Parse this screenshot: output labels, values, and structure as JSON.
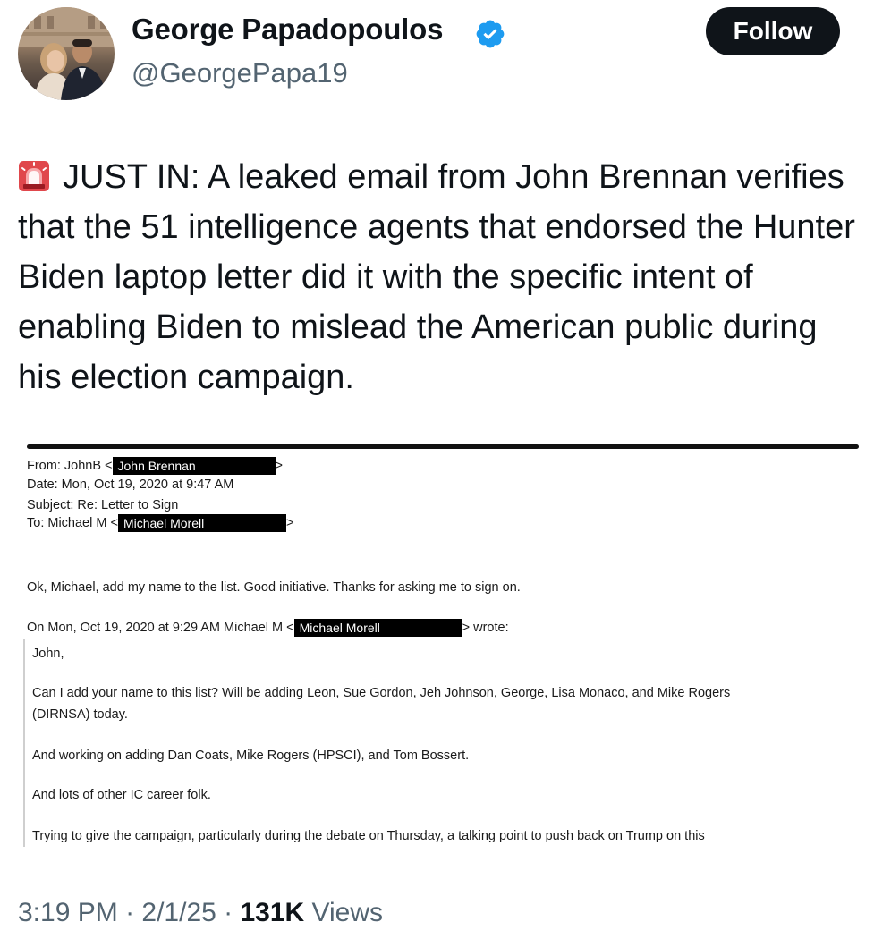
{
  "author": {
    "name": "George Papadopoulos",
    "handle": "@GeorgePapa19",
    "follow_label": "Follow"
  },
  "tweet": {
    "text": "JUST IN: A leaked email from John Brennan verifies that the 51 intelligence agents that endorsed the Hunter Biden laptop letter did it with the specific intent of enabling Biden to mislead the American public during his election campaign."
  },
  "email": {
    "from_label": "From: JohnB <",
    "from_redacted": "John Brennan",
    "from_close": ">",
    "date": "Date: Mon, Oct 19, 2020 at 9:47 AM",
    "subject": "Subject: Re: Letter to Sign",
    "to_label": "To: Michael M <",
    "to_redacted": "Michael Morell",
    "to_close": ">",
    "reply": "Ok, Michael, add my name to the list.  Good initiative.  Thanks for asking me to sign on.",
    "quote_header_pre": "On Mon, Oct 19, 2020 at 9:29 AM Michael M <",
    "quote_header_redacted": "Michael Morell",
    "quote_header_post": "> wrote:",
    "quoted_lines": [
      "John,",
      "Can I add your name to this list?  Will be adding Leon, Sue Gordon, Jeh Johnson, George, Lisa Monaco, and Mike Rogers",
      "(DIRNSA) today.",
      "And working on adding Dan Coats, Mike Rogers (HPSCI), and Tom Bossert.",
      "And lots of other IC career folk.",
      "Trying to give the campaign, particularly during the debate on Thursday, a talking point to push back on Trump on this"
    ]
  },
  "meta": {
    "time": "3:19 PM",
    "separator": " · ",
    "date": "2/1/25",
    "views_count": "131K",
    "views_label": " Views"
  },
  "colors": {
    "text": "#0f1419",
    "secondary": "#536471",
    "verified": "#1d9bf0",
    "follow_bg": "#0f1419"
  },
  "icons": {
    "verified": "verified-badge-icon",
    "siren": "police-siren-icon"
  }
}
